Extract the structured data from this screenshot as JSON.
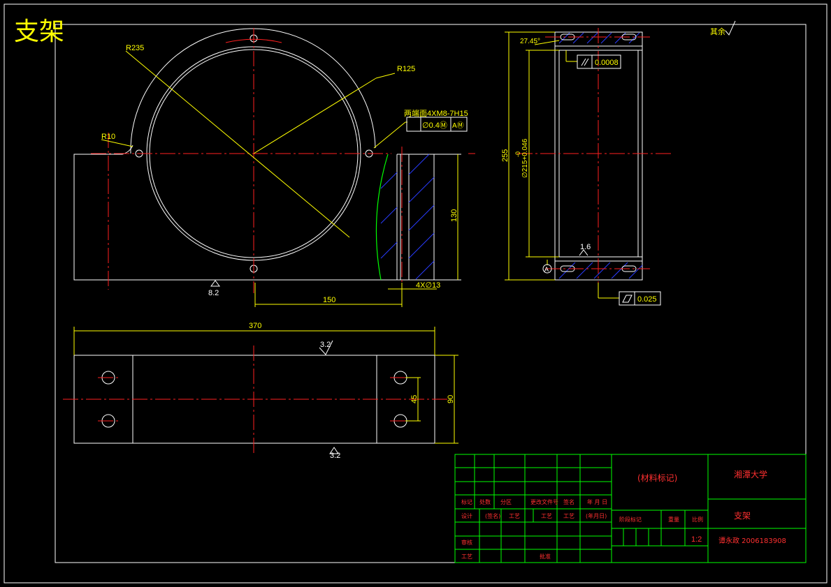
{
  "drawing": {
    "title": "支架",
    "roughness_rest": "其余",
    "dims": {
      "r235": "R235",
      "r125": "R125",
      "r10": "R10",
      "holes_note": "两端面4XM8-7H15",
      "pos_tol": "∅0.4Ⓜ",
      "pos_ref": "AⓂ",
      "h130": "130",
      "d150": "150",
      "holes13": "4X∅13",
      "d370": "370",
      "d90": "90",
      "d45": "45",
      "ang": "27.45°",
      "h255": "255",
      "bore": "∅215+0.046",
      "bore_low": "-0",
      "circ_tol": "0.0008",
      "flat_tol": "0.025",
      "rough16": "1.6",
      "rough82": "8.2",
      "rough32a": "3.2",
      "rough32b": "3.2",
      "datum": "A"
    },
    "title_block": {
      "material": "(材料标记)",
      "university": "湘潭大学",
      "part_name": "支架",
      "scale": "1:2",
      "student": "谭永政 2006183908",
      "row_labels": [
        "标记",
        "处数",
        "分区",
        "更改文件号",
        "签名",
        "年 月 日"
      ],
      "row2_labels": [
        "设计",
        "(签名)",
        "工艺",
        "工艺",
        "(年月日)"
      ],
      "stage_label": "阶段标记",
      "weight_label": "重量",
      "scale_label": "比例",
      "review": "审核",
      "process": "工艺",
      "approve": "批准"
    },
    "colors": {
      "line": "#ffffff",
      "center": "#ff2020",
      "dim": "#ffff00",
      "hatch": "#2a3cff",
      "block": "#00ff00",
      "title": "#ffff00"
    }
  }
}
